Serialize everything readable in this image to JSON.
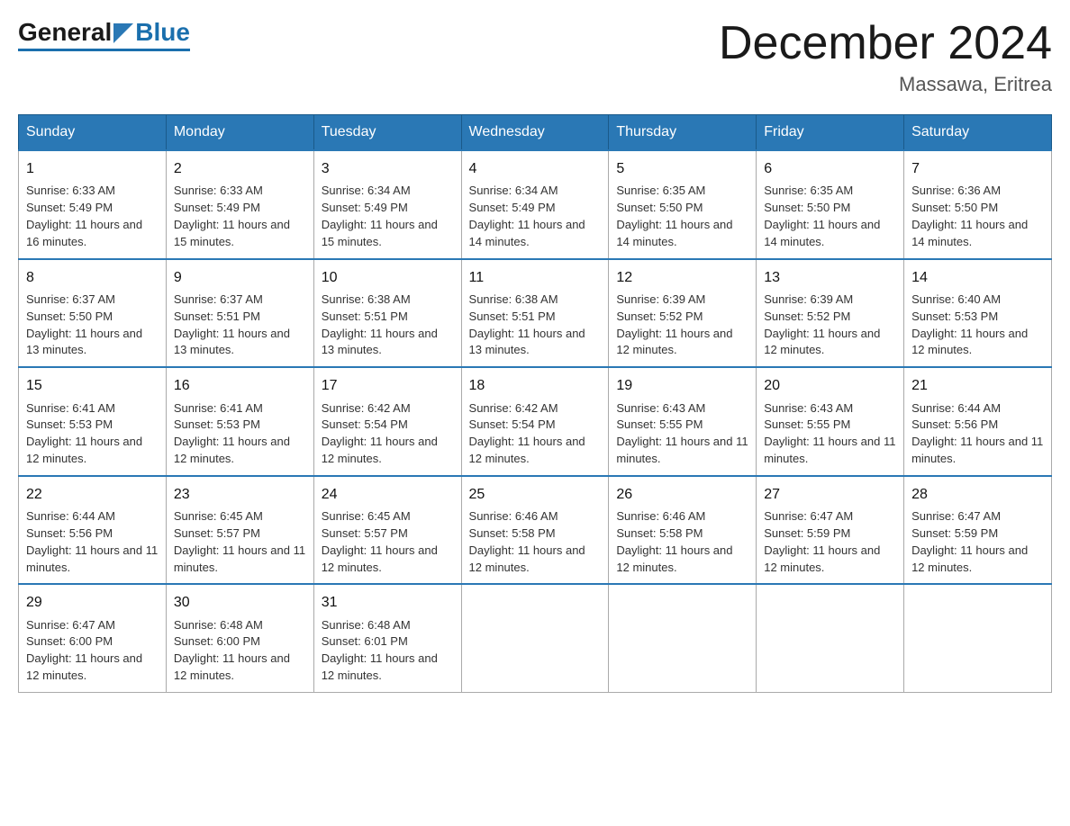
{
  "header": {
    "logo": {
      "general": "General",
      "blue": "Blue"
    },
    "title": "December 2024",
    "subtitle": "Massawa, Eritrea"
  },
  "calendar": {
    "days_of_week": [
      "Sunday",
      "Monday",
      "Tuesday",
      "Wednesday",
      "Thursday",
      "Friday",
      "Saturday"
    ],
    "weeks": [
      [
        {
          "day": "1",
          "sunrise": "6:33 AM",
          "sunset": "5:49 PM",
          "daylight": "11 hours and 16 minutes."
        },
        {
          "day": "2",
          "sunrise": "6:33 AM",
          "sunset": "5:49 PM",
          "daylight": "11 hours and 15 minutes."
        },
        {
          "day": "3",
          "sunrise": "6:34 AM",
          "sunset": "5:49 PM",
          "daylight": "11 hours and 15 minutes."
        },
        {
          "day": "4",
          "sunrise": "6:34 AM",
          "sunset": "5:49 PM",
          "daylight": "11 hours and 14 minutes."
        },
        {
          "day": "5",
          "sunrise": "6:35 AM",
          "sunset": "5:50 PM",
          "daylight": "11 hours and 14 minutes."
        },
        {
          "day": "6",
          "sunrise": "6:35 AM",
          "sunset": "5:50 PM",
          "daylight": "11 hours and 14 minutes."
        },
        {
          "day": "7",
          "sunrise": "6:36 AM",
          "sunset": "5:50 PM",
          "daylight": "11 hours and 14 minutes."
        }
      ],
      [
        {
          "day": "8",
          "sunrise": "6:37 AM",
          "sunset": "5:50 PM",
          "daylight": "11 hours and 13 minutes."
        },
        {
          "day": "9",
          "sunrise": "6:37 AM",
          "sunset": "5:51 PM",
          "daylight": "11 hours and 13 minutes."
        },
        {
          "day": "10",
          "sunrise": "6:38 AM",
          "sunset": "5:51 PM",
          "daylight": "11 hours and 13 minutes."
        },
        {
          "day": "11",
          "sunrise": "6:38 AM",
          "sunset": "5:51 PM",
          "daylight": "11 hours and 13 minutes."
        },
        {
          "day": "12",
          "sunrise": "6:39 AM",
          "sunset": "5:52 PM",
          "daylight": "11 hours and 12 minutes."
        },
        {
          "day": "13",
          "sunrise": "6:39 AM",
          "sunset": "5:52 PM",
          "daylight": "11 hours and 12 minutes."
        },
        {
          "day": "14",
          "sunrise": "6:40 AM",
          "sunset": "5:53 PM",
          "daylight": "11 hours and 12 minutes."
        }
      ],
      [
        {
          "day": "15",
          "sunrise": "6:41 AM",
          "sunset": "5:53 PM",
          "daylight": "11 hours and 12 minutes."
        },
        {
          "day": "16",
          "sunrise": "6:41 AM",
          "sunset": "5:53 PM",
          "daylight": "11 hours and 12 minutes."
        },
        {
          "day": "17",
          "sunrise": "6:42 AM",
          "sunset": "5:54 PM",
          "daylight": "11 hours and 12 minutes."
        },
        {
          "day": "18",
          "sunrise": "6:42 AM",
          "sunset": "5:54 PM",
          "daylight": "11 hours and 12 minutes."
        },
        {
          "day": "19",
          "sunrise": "6:43 AM",
          "sunset": "5:55 PM",
          "daylight": "11 hours and 11 minutes."
        },
        {
          "day": "20",
          "sunrise": "6:43 AM",
          "sunset": "5:55 PM",
          "daylight": "11 hours and 11 minutes."
        },
        {
          "day": "21",
          "sunrise": "6:44 AM",
          "sunset": "5:56 PM",
          "daylight": "11 hours and 11 minutes."
        }
      ],
      [
        {
          "day": "22",
          "sunrise": "6:44 AM",
          "sunset": "5:56 PM",
          "daylight": "11 hours and 11 minutes."
        },
        {
          "day": "23",
          "sunrise": "6:45 AM",
          "sunset": "5:57 PM",
          "daylight": "11 hours and 11 minutes."
        },
        {
          "day": "24",
          "sunrise": "6:45 AM",
          "sunset": "5:57 PM",
          "daylight": "11 hours and 12 minutes."
        },
        {
          "day": "25",
          "sunrise": "6:46 AM",
          "sunset": "5:58 PM",
          "daylight": "11 hours and 12 minutes."
        },
        {
          "day": "26",
          "sunrise": "6:46 AM",
          "sunset": "5:58 PM",
          "daylight": "11 hours and 12 minutes."
        },
        {
          "day": "27",
          "sunrise": "6:47 AM",
          "sunset": "5:59 PM",
          "daylight": "11 hours and 12 minutes."
        },
        {
          "day": "28",
          "sunrise": "6:47 AM",
          "sunset": "5:59 PM",
          "daylight": "11 hours and 12 minutes."
        }
      ],
      [
        {
          "day": "29",
          "sunrise": "6:47 AM",
          "sunset": "6:00 PM",
          "daylight": "11 hours and 12 minutes."
        },
        {
          "day": "30",
          "sunrise": "6:48 AM",
          "sunset": "6:00 PM",
          "daylight": "11 hours and 12 minutes."
        },
        {
          "day": "31",
          "sunrise": "6:48 AM",
          "sunset": "6:01 PM",
          "daylight": "11 hours and 12 minutes."
        },
        null,
        null,
        null,
        null
      ]
    ],
    "labels": {
      "sunrise": "Sunrise:",
      "sunset": "Sunset:",
      "daylight": "Daylight:"
    }
  }
}
